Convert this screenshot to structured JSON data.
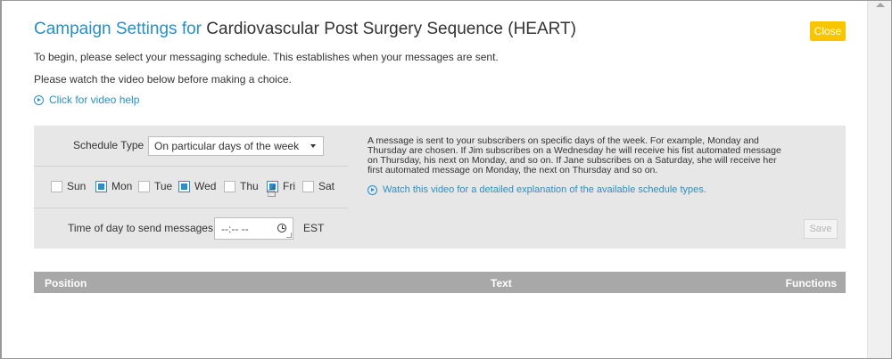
{
  "title": {
    "lead": "Campaign Settings for",
    "campaign_name": "Cardiovascular Post Surgery Sequence (HEART)"
  },
  "close_label": "Close",
  "intro": {
    "line1": "To begin, please select your messaging schedule. This establishes when your messages are sent.",
    "line2": "Please watch the video below before making a choice.",
    "video_link": "Click for video help"
  },
  "schedule": {
    "type_label": "Schedule Type",
    "type_value": "On particular days of the week",
    "days": [
      {
        "label": "Sun",
        "checked": false
      },
      {
        "label": "Mon",
        "checked": true
      },
      {
        "label": "Tue",
        "checked": false
      },
      {
        "label": "Wed",
        "checked": true
      },
      {
        "label": "Thu",
        "checked": false
      },
      {
        "label": "Fri",
        "checked": true
      },
      {
        "label": "Sat",
        "checked": false
      }
    ],
    "time_label": "Time of day to send messages",
    "time_placeholder": "--:-- --",
    "timezone": "EST",
    "description": "A message is sent to your subscribers on specific days of the week. For example, Monday and Thursday are chosen. If Jim subscribes on a Wednesday he will receive his fist automated message on Thursday, his next on Monday, and so on. If Jane subscribes on a Saturday, she will receive her first automated message on Monday, the next on Thursday and so on.",
    "explain_link": "Watch this video for a detailed explanation of the available schedule types.",
    "save_label": "Save"
  },
  "table": {
    "columns": [
      "Position",
      "Text",
      "Functions"
    ]
  },
  "icons": {
    "play": "play-circle-icon",
    "dropdown": "chevron-down-icon",
    "clock": "clock-icon",
    "cursor": "hand-pointer-icon"
  },
  "colors": {
    "accent": "#2a8fc4",
    "close_button": "#f7c600",
    "panel_bg": "#e7e7e7",
    "table_header_bg": "#a8a8a8"
  }
}
